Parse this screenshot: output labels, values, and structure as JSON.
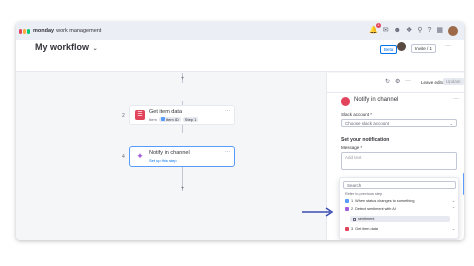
{
  "app": {
    "brand": "monday",
    "brand_sub": "work management",
    "notification_count": "1",
    "brand_colors": [
      "#e2445c",
      "#fdab3d",
      "#00c875"
    ]
  },
  "top_icons": [
    "bell-icon",
    "inbox-icon",
    "people-icon",
    "puzzle-icon",
    "search-icon",
    "help-icon",
    "apps-grid-icon"
  ],
  "board": {
    "title": "My workflow",
    "beta": "Beta",
    "invite": "Invite / 1"
  },
  "workflow": {
    "nodes": [
      {
        "number": "2",
        "title": "Get item data",
        "sub_prefix": "Item",
        "chip1": "Item ID",
        "chip2": "Step 1"
      },
      {
        "number": "4",
        "title": "Notify in channel",
        "link": "Set up this step"
      }
    ]
  },
  "panel": {
    "leave_editor": "Leave editor",
    "update": "Update",
    "title": "Notify in channel",
    "slack_account_label": "Slack account *",
    "slack_account_placeholder": "Choose slack account",
    "section_title": "Set your notification",
    "message_label": "Message *",
    "message_placeholder": "Add text",
    "dropdown": {
      "search_placeholder": "Search",
      "refer_label": "Refer to previous step",
      "rows": [
        {
          "num": "1",
          "label": "When status changes to something",
          "color": "#579bfc"
        },
        {
          "num": "2",
          "label": "Detect sentiment with AI",
          "color": "#a25ddc"
        },
        {
          "num": "3",
          "label": "Get item data",
          "color": "#e2445c"
        }
      ],
      "sub_item": "sentiment"
    }
  },
  "accent_color": "#0073ea"
}
